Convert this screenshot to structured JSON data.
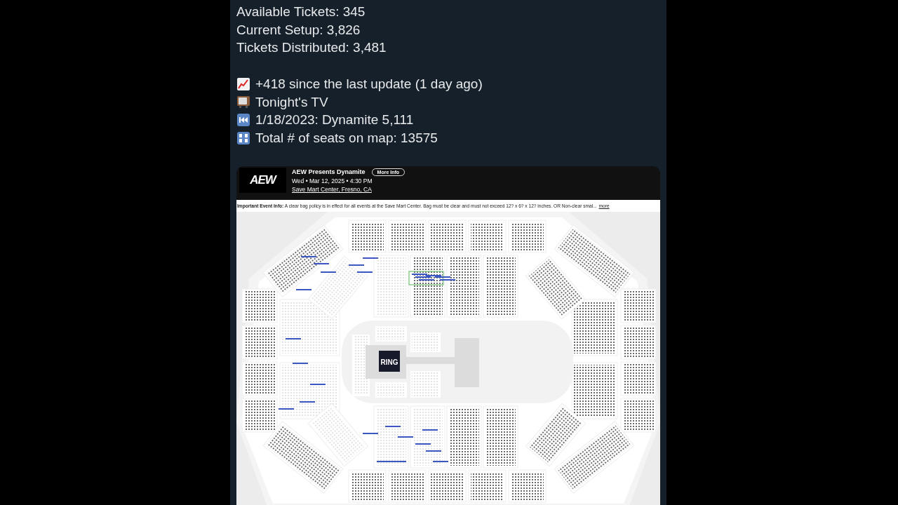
{
  "post": {
    "stats": [
      "Available Tickets: 345",
      "Current Setup: 3,826",
      "Tickets Distributed: 3,481"
    ],
    "updates": [
      {
        "kind": "chart",
        "text": "+418 since the last update (1 day ago)"
      },
      {
        "kind": "tv",
        "text": "Tonight's TV"
      },
      {
        "kind": "rewind",
        "text": "1/18/2023: Dynamite 5,111"
      },
      {
        "kind": "numbers",
        "text": "Total # of seats on map: 13575"
      }
    ]
  },
  "event": {
    "logo": "AEW",
    "title": "AEW Presents Dynamite",
    "button": "More Info",
    "date": "Wed • Mar 12, 2025 • 4:30 PM",
    "venue": "Save Mart Center, Fresno, CA",
    "notice": "**Important Event Info:** A clear bag policy is in effect for all events at the Save Mart Center. Bag must be clear and must not exceed 12? x 6? x 12? inches. OR Non-clear smal...",
    "more": "more"
  },
  "map": {
    "stage_label": "RING"
  }
}
